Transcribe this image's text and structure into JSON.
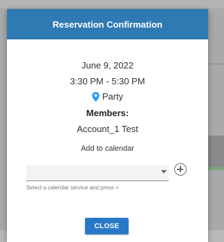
{
  "dialog": {
    "title": "Reservation Confirmation",
    "date": "June 9, 2022",
    "time": "3:30 PM - 5:30 PM",
    "event_name": "Party",
    "event_icon": "location-pin-icon",
    "members_label": "Members:",
    "member": "Account_1 Test",
    "add_to_calendar": "Add to calendar",
    "calendar_select_value": "",
    "helper_text": "Select a calendar service and press +",
    "close_label": "CLOSE"
  },
  "colors": {
    "header": "#2f7ab2",
    "close_button": "#2878c8",
    "pin": "#2a9df4",
    "overlay": "#a9a9a9"
  }
}
